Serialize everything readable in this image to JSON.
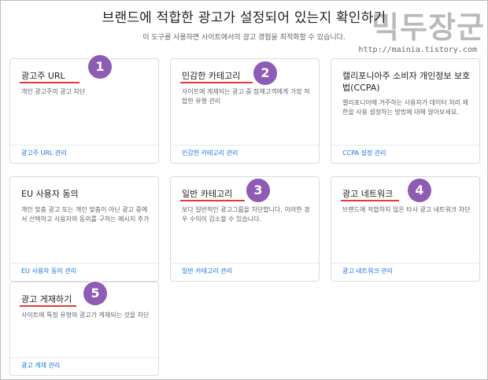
{
  "header": {
    "title": "브랜드에 적합한 광고가 설정되어 있는지 확인하기",
    "subtitle": "이 도구를 사용하면 사이트에서의 광고 경험을 최적화할 수 있습니다."
  },
  "watermark": {
    "logo_text": "믹두장군",
    "url": "http://mainia.tistory.com"
  },
  "accent_colors": {
    "underline": "#e53935",
    "badge": "#8e5bb5",
    "link": "#1a73e8"
  },
  "cards": [
    {
      "title": "광고주 URL",
      "desc": "개인 광고주의 광고 차단",
      "link": "광고주 URL 관리",
      "badge": "1"
    },
    {
      "title": "민감한 카테고리",
      "desc": "사이트에 게재되는 광고 중 잠재고객에게 가장 적합한 유형 관리",
      "link": "민감한 카테고리 관리",
      "badge": "2"
    },
    {
      "title": "캘리포니아주 소비자 개인정보 보호법(CCPA)",
      "desc": "캘리포니아에 거주하는 사용자가 데이터 처리 제한을 사용 설정하는 방법에 대해 알아보세요.",
      "link": "CCPA 설정 관리",
      "badge": ""
    },
    {
      "title": "EU 사용자 동의",
      "desc": "개인 맞춤 광고 또는 개인 맞춤이 아닌 광고 중에서 선택하고 사용자의 동의를 구하는 메시지 추가",
      "link": "EU 사용자 동의 관리",
      "badge": ""
    },
    {
      "title": "일반 카테고리",
      "desc": "보다 일반적인 광고그룹을 차단합니다. 이러한 경우 수익이 감소할 수 있습니다.",
      "link": "일반 카테고리 관리",
      "badge": "3"
    },
    {
      "title": "광고 네트워크",
      "desc": "브랜드에 적합하지 않은 타사 광고 네트워크 차단",
      "link": "광고 네트워크 관리",
      "badge": "4"
    },
    {
      "title": "광고 게재하기",
      "desc": "사이트에 특정 유형의 광고가 게재되는 것을 차단",
      "link": "광고 게재 관리",
      "badge": "5"
    }
  ]
}
